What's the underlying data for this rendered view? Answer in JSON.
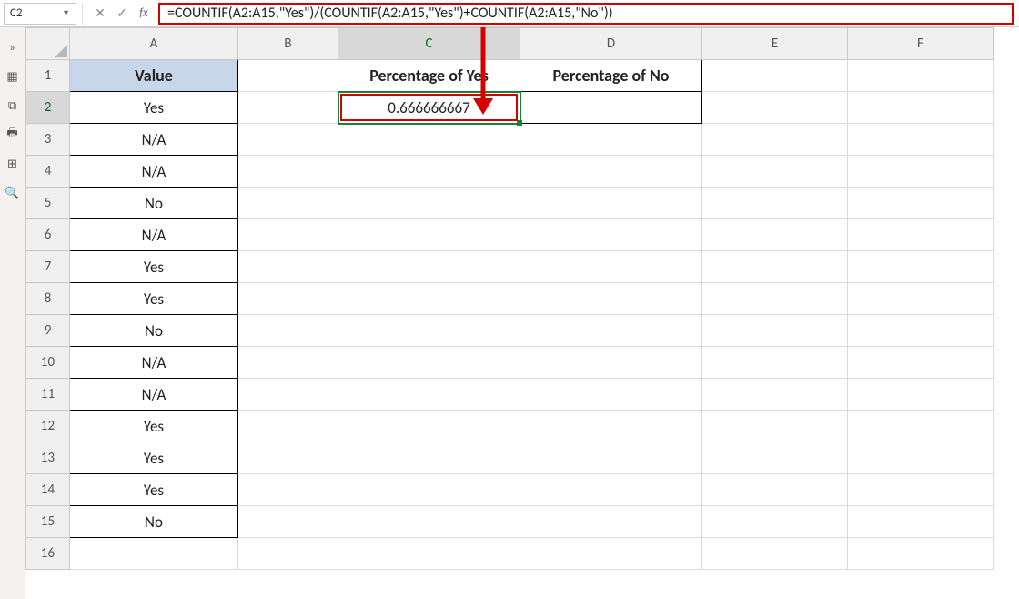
{
  "nameBox": {
    "value": "C2"
  },
  "formulaBar": {
    "cancel_glyph": "✕",
    "enter_glyph": "✓",
    "fx_label": "fx",
    "formula": "=COUNTIF(A2:A15,\"Yes\")/(COUNTIF(A2:A15,\"Yes\")+COUNTIF(A2:A15,\"No\"))"
  },
  "sidebarIcons": [
    "»",
    "▦",
    "⧉",
    "🖶",
    "⊞",
    "🔍"
  ],
  "columns": [
    "A",
    "B",
    "C",
    "D",
    "E",
    "F"
  ],
  "selectedCol": "C",
  "selectedRow": 2,
  "rowCount": 16,
  "headers": {
    "A1": "Value",
    "C1": "Percentage of Yes",
    "D1": "Percentage of No"
  },
  "columnA": [
    "Yes",
    "N/A",
    "N/A",
    "No",
    "N/A",
    "Yes",
    "Yes",
    "No",
    "N/A",
    "N/A",
    "Yes",
    "Yes",
    "Yes",
    "No"
  ],
  "cells": {
    "C2": "0.666666667"
  },
  "colors": {
    "annotation_red": "#d40000",
    "header_blue": "#c8d6ea",
    "selection_green": "#1a7f37"
  }
}
